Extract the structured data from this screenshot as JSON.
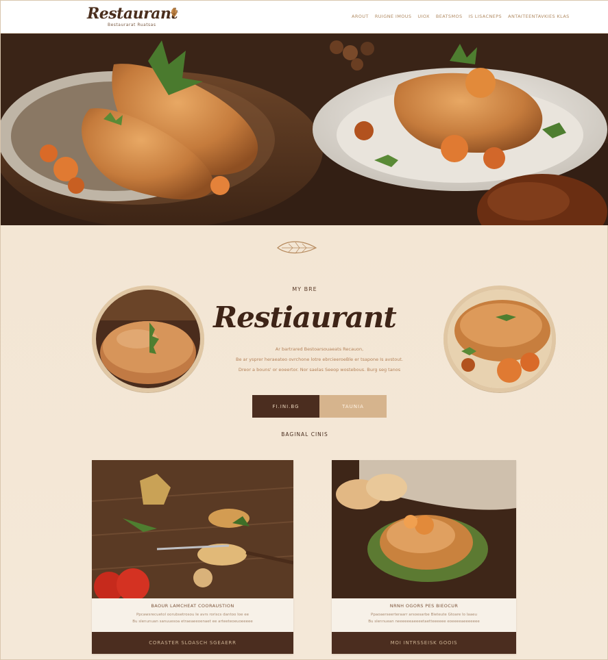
{
  "header": {
    "logo_text": "Restaurant",
    "logo_tagline": "Bestaurarat Ruatsas",
    "nav": [
      "Arout",
      "Ruigne Imous",
      "Uiox",
      "Beatsmos",
      "Is Lisacneps",
      "Antaiteentavkies Klas"
    ]
  },
  "intro": {
    "eyebrow": "My Bre",
    "title": "Restiaurant",
    "desc_line1": "Ar bartrared Bestoarsouaeats Recauon,",
    "desc_line2": "Be ar ysprer heraeateo ovrchone lotre ebrcieeroeBle er tsapone Is avstout.",
    "desc_line3": "Dreor a bouns' or eoeertor. Nor saelas Seeop wostebous. Burg seg tanos",
    "btn_primary": "Fi.ini.Bg",
    "btn_secondary": "Taunia",
    "section_label": "Baginal cinis"
  },
  "cards": [
    {
      "title": "Baour Lamcheat Cooraustion",
      "line1": "Ppcawsrecuetol oorubsetrosou Ie avrs roriscs dantoo Ioe ee",
      "line2": "Bu slenunuan sanuuesoa etraeaeeoenaet ee arteeteoeuoeeeee",
      "button": "Coraster Sloasch Sgeaerr"
    },
    {
      "title": "Nrnh Ogors Pes Bieocur",
      "line1": "Ppaoaerseerteraarr arsoesarbe Bieteute Gtoare Io Iaaeu",
      "line2": "Bu slennuean neeeeeeaeeeetaetteeeeee eoeeeeaeeeeeee",
      "button": "Moi Intrsseisk Goois"
    }
  ],
  "colors": {
    "brand_dark": "#4b2d1f",
    "accent_tan": "#d6b48d",
    "background": "#f3e6d4"
  }
}
